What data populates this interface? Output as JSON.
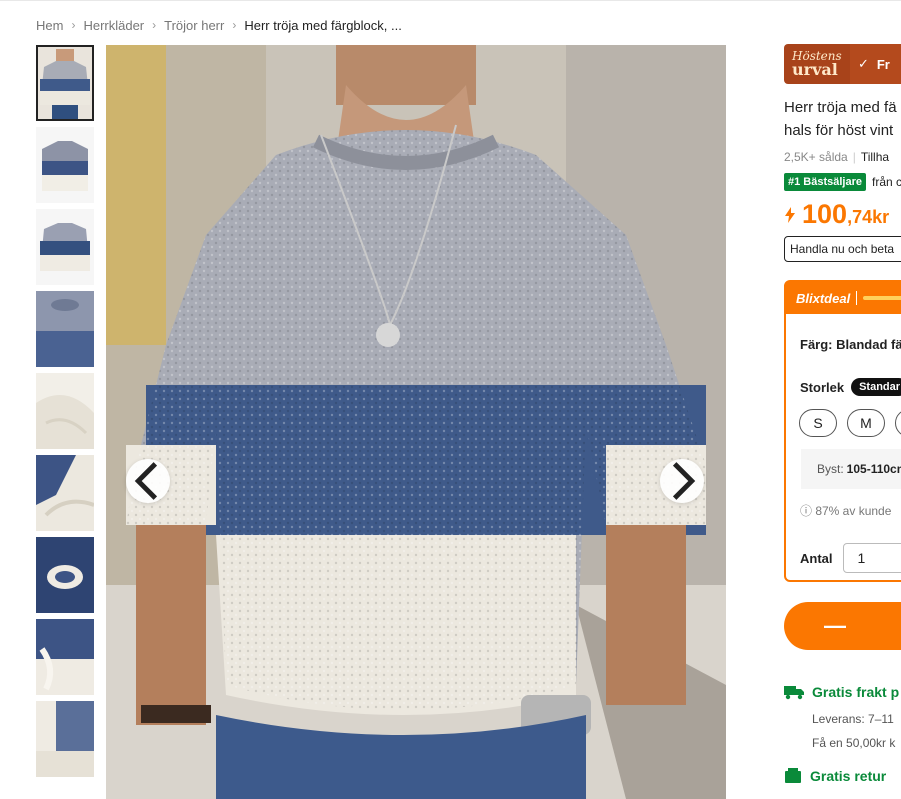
{
  "breadcrumb": {
    "items": [
      "Hem",
      "Herrkläder",
      "Tröjor herr"
    ],
    "current": "Herr tröja med färgblock, ..."
  },
  "thumbnails": [
    "Bild 1",
    "Bild 2",
    "Bild 3",
    "Bild 4",
    "Bild 5",
    "Bild 6",
    "Bild 7",
    "Bild 8",
    "Bild 9"
  ],
  "badges": {
    "autumn_line1": "Höstens",
    "autumn_line2": "urval",
    "free_label": "Fr"
  },
  "product": {
    "title_line1": "Herr tröja med fä",
    "title_line2": "hals för höst vint",
    "sold": "2,5K+ sålda",
    "availability": "Tillha",
    "bestseller_tag": "#1 Bästsäljare",
    "bestseller_suffix": "från c",
    "price_big": "100",
    "price_small": ",74kr",
    "buy_now": "Handla nu och beta"
  },
  "flash_deal": {
    "label": "Blixtdeal",
    "color_label": "Färg: Blandad fä",
    "size_label": "Storlek",
    "size_chart_pill": "Standar",
    "sizes": [
      "S",
      "M",
      ""
    ],
    "measure_label": "Byst:",
    "measure_value": "105-110cm",
    "fit_note": "ⓘ 87% av kunde",
    "qty_label": "Antal",
    "qty_value": "1"
  },
  "cart": {
    "label": "—"
  },
  "shipping": {
    "title": "Gratis frakt p",
    "delivery": "Leverans: 7–11",
    "credit": "Få en 50,00kr k",
    "returns": "Gratis retur"
  },
  "colors": {
    "accent": "#fb7701",
    "green": "#0a8a3a",
    "autumn": "#a8431a"
  },
  "icons": {
    "prev": "chevron-left-icon",
    "next": "chevron-right-icon",
    "bolt": "lightning-icon",
    "truck": "truck-icon",
    "return": "return-icon"
  }
}
